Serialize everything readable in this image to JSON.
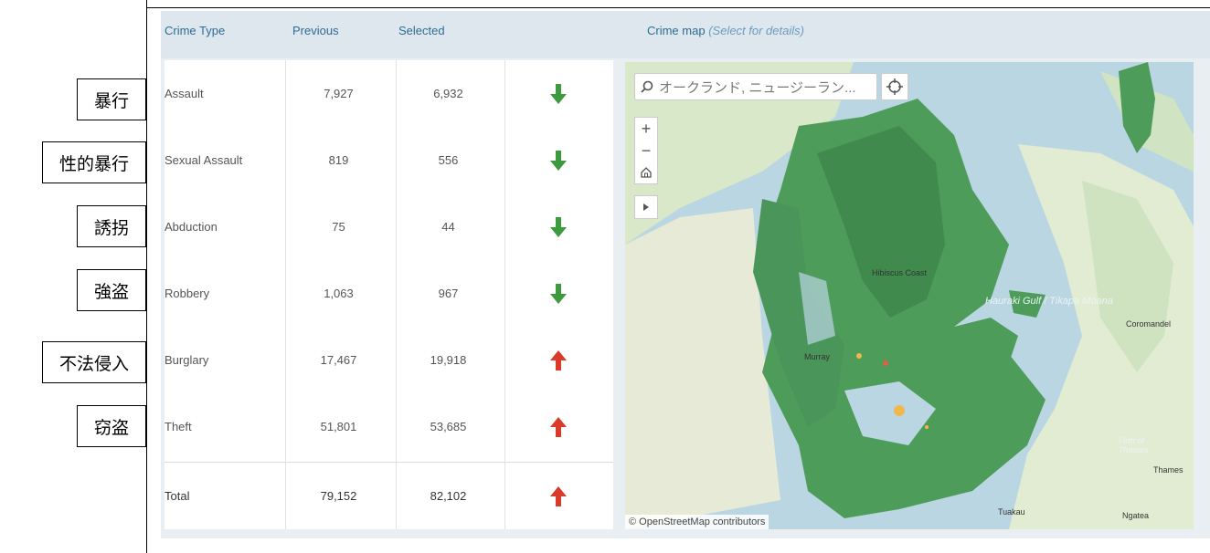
{
  "annotations": [
    "暴行",
    "性的暴行",
    "誘拐",
    "強盗",
    "不法侵入",
    "窃盗"
  ],
  "header": {
    "crime_type": "Crime Type",
    "previous": "Previous",
    "selected": "Selected",
    "map_title": "Crime map",
    "map_hint": "(Select for details)"
  },
  "rows": [
    {
      "type": "Assault",
      "previous": "7,927",
      "selected": "6,932",
      "trend": "down"
    },
    {
      "type": "Sexual Assault",
      "previous": "819",
      "selected": "556",
      "trend": "down"
    },
    {
      "type": "Abduction",
      "previous": "75",
      "selected": "44",
      "trend": "down"
    },
    {
      "type": "Robbery",
      "previous": "1,063",
      "selected": "967",
      "trend": "down"
    },
    {
      "type": "Burglary",
      "previous": "17,467",
      "selected": "19,918",
      "trend": "up"
    },
    {
      "type": "Theft",
      "previous": "51,801",
      "selected": "53,685",
      "trend": "up"
    }
  ],
  "total": {
    "type": "Total",
    "previous": "79,152",
    "selected": "82,102",
    "trend": "up"
  },
  "map": {
    "search_placeholder": "オークランド, ニュージーラン...",
    "attribution": "© OpenStreetMap contributors",
    "labels": [
      "Hauraki Gulf / Tikapa Moana",
      "Coromandel",
      "Thames",
      "Firth of Thames",
      "Murray",
      "Ngatea",
      "Tuakau",
      "Hibiscus Coast"
    ]
  },
  "colors": {
    "down": "#3e9a3e",
    "up": "#d93a2a",
    "region": "#4e9c59",
    "header_text": "#2e6c95"
  }
}
